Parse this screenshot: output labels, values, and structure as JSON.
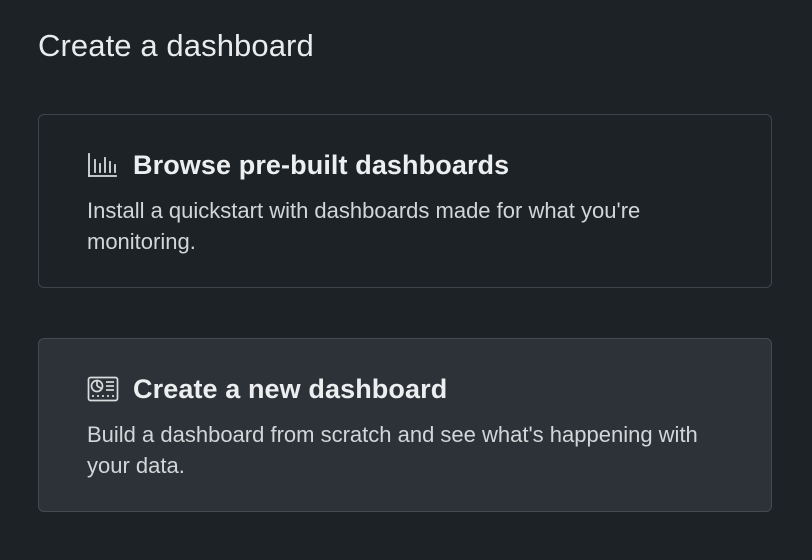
{
  "page": {
    "title": "Create a dashboard"
  },
  "options": [
    {
      "icon": "bar-chart-icon",
      "title": "Browse pre-built dashboards",
      "description": "Install a quickstart with dashboards made for what you're monitoring."
    },
    {
      "icon": "dashboard-icon",
      "title": "Create a new dashboard",
      "description": "Build a dashboard from scratch and see what's happening with your data."
    }
  ],
  "colors": {
    "background": "#1d2226",
    "card_border": "#3d454b",
    "card_selected_background": "#2c3237",
    "text_primary": "#eceeef",
    "text_secondary": "#d2d6d8"
  }
}
